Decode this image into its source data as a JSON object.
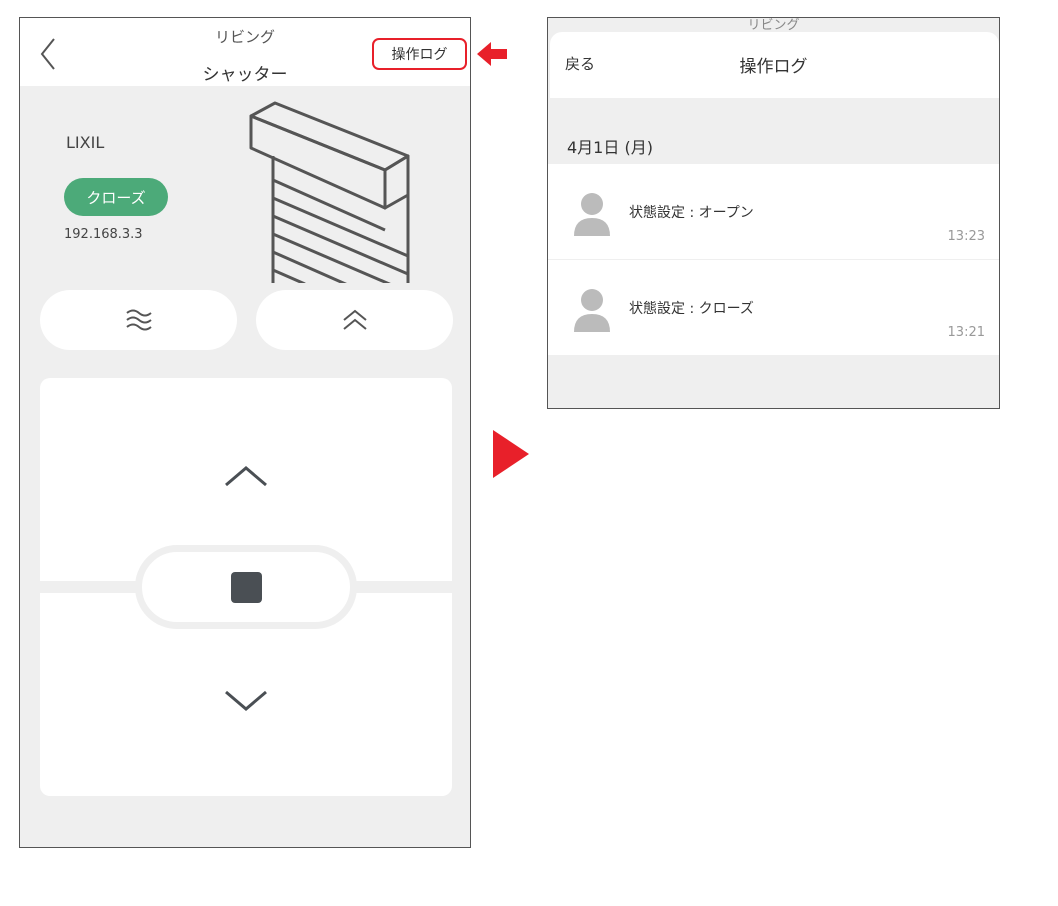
{
  "device_screen": {
    "room": "リビング",
    "device": "シャッター",
    "operation_log_button": "操作ログ",
    "brand": "LIXIL",
    "status": "クローズ",
    "ip_address": "192.168.3.3",
    "pill_left_icon": "wave-icon",
    "pill_right_icon": "double-chevron-up-icon",
    "controls": [
      "open-up-icon",
      "stop-icon",
      "close-down-icon"
    ],
    "colors": {
      "status_badge": "#4caa79",
      "highlight": "#e8202a"
    }
  },
  "log_screen": {
    "ghost_header": "リビング",
    "back": "戻る",
    "title": "操作ログ",
    "date": "4月1日 (月)",
    "entries": [
      {
        "text": "状態設定 : オープン",
        "time": "13:23"
      },
      {
        "text": "状態設定 : クローズ",
        "time": "13:21"
      }
    ]
  }
}
